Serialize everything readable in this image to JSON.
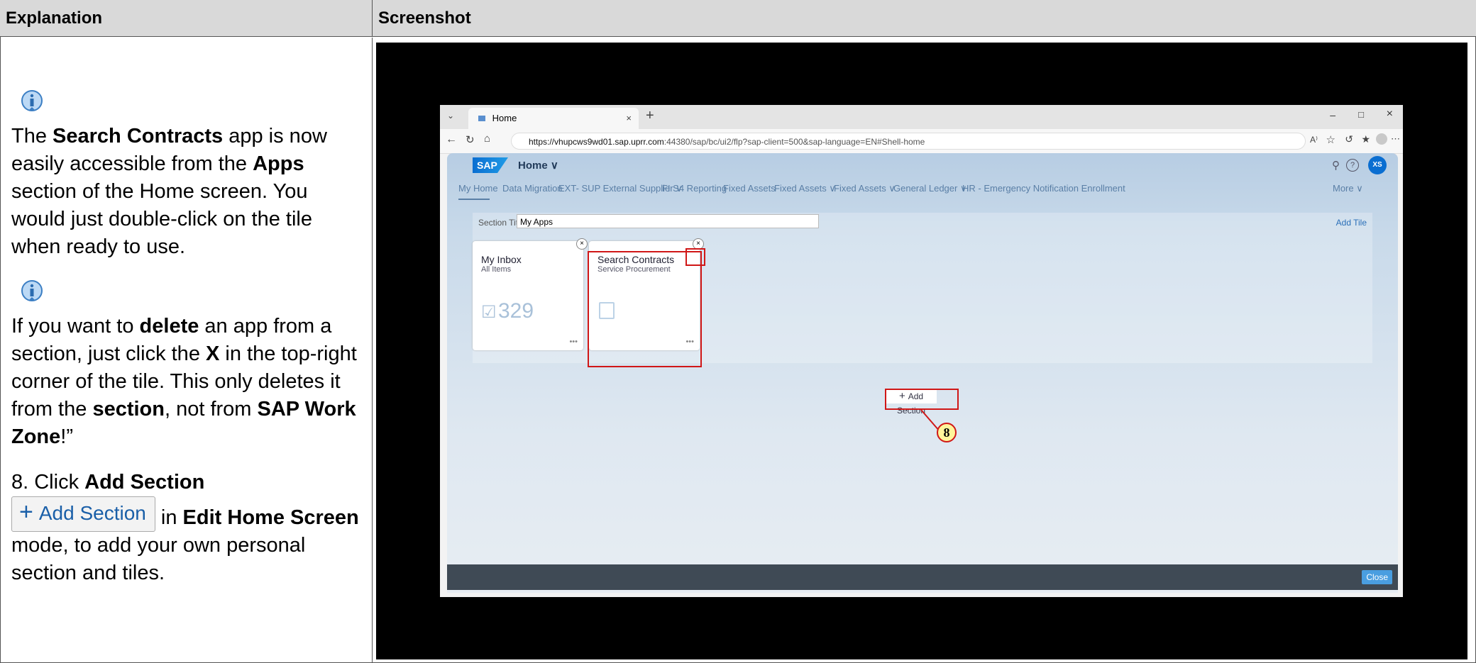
{
  "headers": {
    "left": "Explanation",
    "right": "Screenshot"
  },
  "explanation": {
    "p1": [
      {
        "t": "The ",
        "b": false
      },
      {
        "t": "Search Contracts",
        "b": true
      },
      {
        "t": " app is now easily accessible from the ",
        "b": false
      },
      {
        "t": "Apps",
        "b": true
      },
      {
        "t": " section of the Home screen. You would just double-click on the tile when ready to use.",
        "b": false
      }
    ],
    "p2": [
      {
        "t": "If you want to ",
        "b": false
      },
      {
        "t": "delete",
        "b": true
      },
      {
        "t": " an app from a section, just click the ",
        "b": false
      },
      {
        "t": "X",
        "b": true
      },
      {
        "t": " in the top-right corner of the tile. This only deletes it from the ",
        "b": false
      },
      {
        "t": "section",
        "b": true
      },
      {
        "t": ", not from ",
        "b": false
      },
      {
        "t": "SAP Work Zone",
        "b": true
      },
      {
        "t": "!”",
        "b": false
      }
    ],
    "step_prefix": "8. Click ",
    "step_bold": "Add Section",
    "button_label": "Add Section",
    "step_in": " in ",
    "step_mode": "Edit Home Screen",
    "step_suffix": " mode, to add your own personal section and tiles."
  },
  "browser": {
    "tab_title": "Home",
    "url_host": "https://vhupcws9wd01.sap.uprr.com",
    "url_rest": ":44380/sap/bc/ui2/flp?sap-client=500&sap-language=EN#Shell-home"
  },
  "sap": {
    "logo": "SAP",
    "home": "Home ∨",
    "avatar": "XS",
    "nav": [
      "My Home",
      "Data Migration",
      "EXT- SUP External Supplier ∨",
      "FI S4 Reporting",
      "Fixed Assets",
      "Fixed Assets ∨",
      "Fixed Assets ∨",
      "General Ledger ∨",
      "HR - Emergency Notification Enrollment",
      "More ∨"
    ],
    "section_title_label": "Section Title:",
    "section_title_value": "My Apps",
    "add_tile": "Add Tile",
    "tiles": [
      {
        "title": "My Inbox",
        "subtitle": "All Items",
        "count": "329"
      },
      {
        "title": "Search Contracts",
        "subtitle": "Service Procurement",
        "count": ""
      }
    ],
    "add_section": "Add Section",
    "step_marker": "8",
    "close": "Close"
  }
}
